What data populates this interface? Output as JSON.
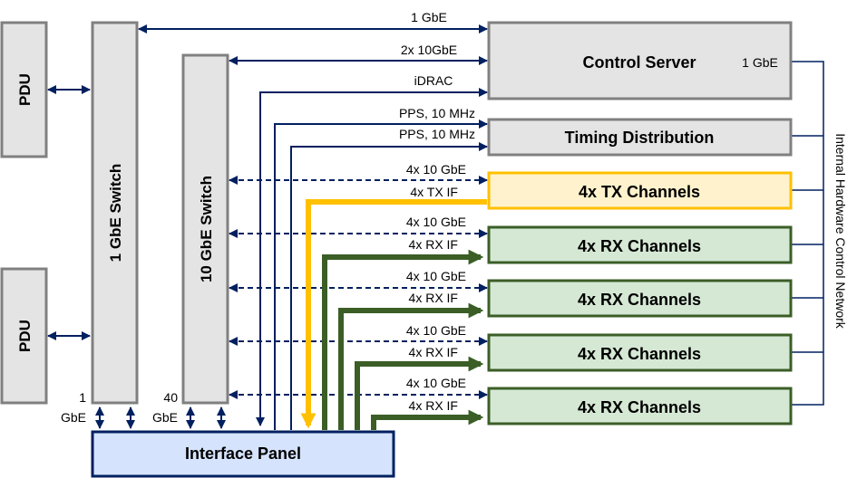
{
  "blocks": {
    "pdu_top": "PDU",
    "pdu_bottom": "PDU",
    "switch_1gbe": "1 GbE Switch",
    "switch_10gbe": "10 GbE Switch",
    "control_server": "Control Server",
    "control_server_port": "1 GbE",
    "timing_distribution": "Timing Distribution",
    "tx_channels": "4x TX Channels",
    "rx_channels": [
      "4x RX Channels",
      "4x RX Channels",
      "4x RX Channels",
      "4x RX Channels"
    ],
    "interface_panel": "Interface Panel"
  },
  "links": {
    "server_1gbe": "1 GbE",
    "server_10gbe": "2x 10GbE",
    "idrac": "iDRAC",
    "pps_1": "PPS, 10 MHz",
    "pps_2": "PPS, 10 MHz",
    "tx_10gbe": "4x 10 GbE",
    "tx_if": "4x TX IF",
    "rx_10gbe": [
      "4x 10 GbE",
      "4x 10 GbE",
      "4x 10 GbE",
      "4x 10 GbE"
    ],
    "rx_if": [
      "4x RX IF",
      "4x RX IF",
      "4x RX IF",
      "4x RX IF"
    ],
    "panel_1gbe_num": "1",
    "panel_1gbe_unit": "GbE",
    "panel_40gbe_num": "40",
    "panel_40gbe_unit": "GbE"
  },
  "network_label": "Internal Hardware Control Network",
  "colors": {
    "navy": "#002060",
    "tx": "#ffc000",
    "rx": "#3b5e27",
    "gray_box": "#e4e4e4",
    "interface_panel": "#d5e3fc"
  }
}
